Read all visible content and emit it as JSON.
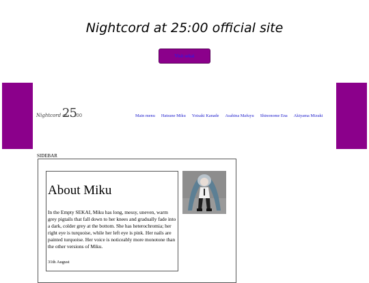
{
  "header": {
    "title": "Nightcord at 25:00 official site"
  },
  "visit_button": {
    "label": "Visit sekai"
  },
  "logo": {
    "text_script": "Nightcord at",
    "text_big": "25",
    "text_small": ":00"
  },
  "nav": {
    "items": [
      {
        "label": "Main menu"
      },
      {
        "label": "Hatsune Miku"
      },
      {
        "label": "Yoisaki Kanade"
      },
      {
        "label": "Asahina Mafuyu"
      },
      {
        "label": "Shinonome Ena"
      },
      {
        "label": "Akiyama Mizuki"
      }
    ]
  },
  "sidebar": {
    "label": "SIDEBAR"
  },
  "about": {
    "title": "About Miku",
    "body": "In the Empty SEKAI, Miku has long, messy, uneven, warm grey pigtails that fall down to her knees and gradually fade into a dark, colder grey at the bottom. She has heterochromia; her right eye is turquoise, while her left eye is pink. Her nails are painted turquoise. Her voice is noticeably more monotone than the other versions of Miku.",
    "date": "31th August"
  },
  "colors": {
    "accent": "#8b008b",
    "link": "#1a1acc"
  }
}
